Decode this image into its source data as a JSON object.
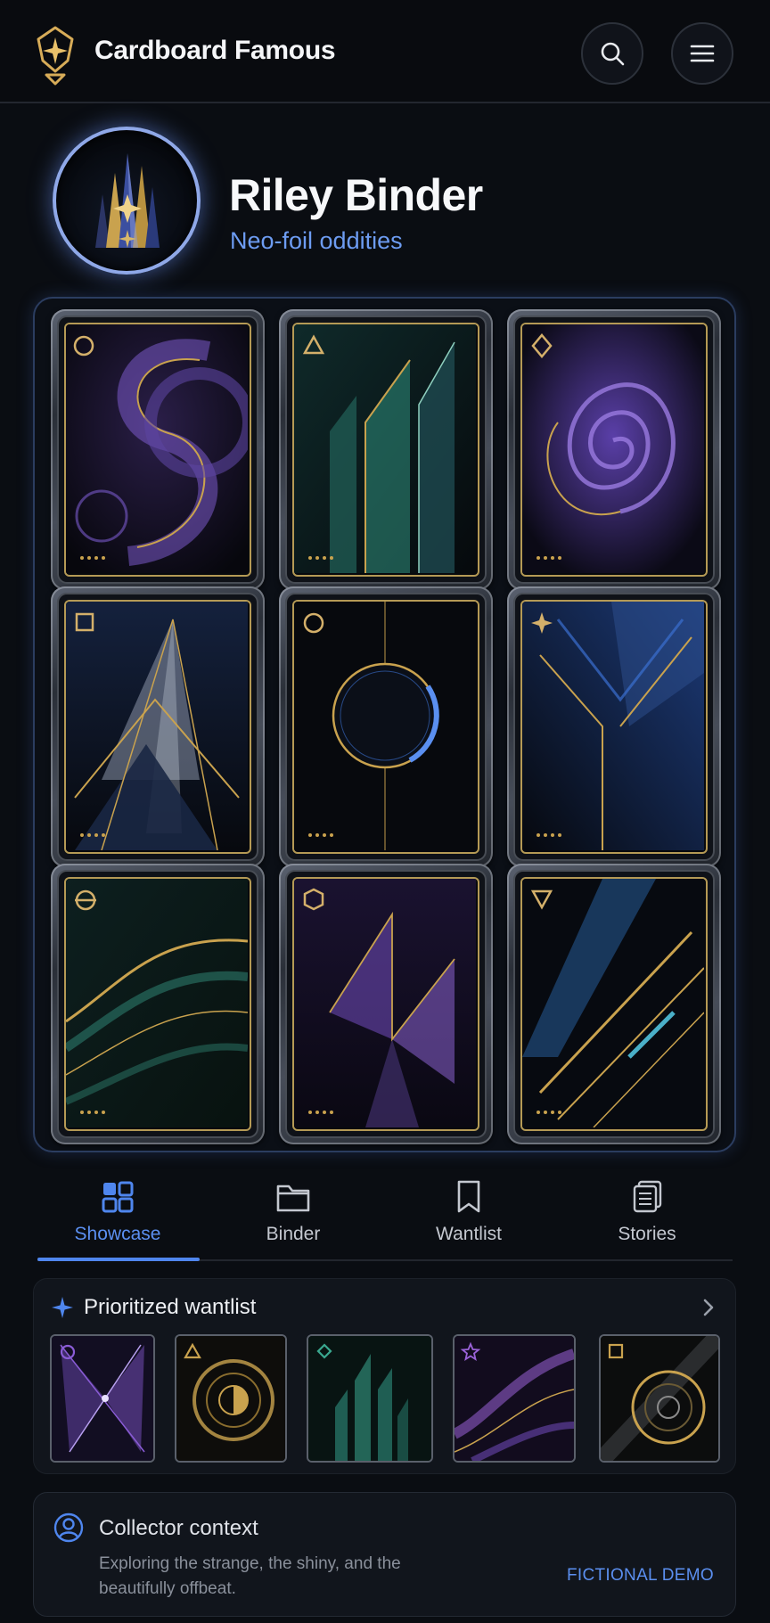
{
  "app": {
    "name": "Cardboard Famous"
  },
  "header": {
    "search_icon": "search-icon",
    "menu_icon": "hamburger-menu-icon"
  },
  "profile": {
    "name": "Riley Binder",
    "tagline": "Neo-foil oddities"
  },
  "binder": {
    "cards": [
      {
        "symbol": "circle",
        "theme": "purple swirl",
        "accent": "#7b55c8"
      },
      {
        "symbol": "triangle",
        "theme": "teal spires",
        "accent": "#2f8f7e"
      },
      {
        "symbol": "diamond",
        "theme": "purple vortex",
        "accent": "#6e4fc4"
      },
      {
        "symbol": "square",
        "theme": "blue peaks",
        "accent": "#3a5fa8"
      },
      {
        "symbol": "circle",
        "theme": "eclipse ring",
        "accent": "#3a6fd0"
      },
      {
        "symbol": "sparkle",
        "theme": "blue chevrons",
        "accent": "#2e4f90"
      },
      {
        "symbol": "theta",
        "theme": "teal waves",
        "accent": "#2c7a6a"
      },
      {
        "symbol": "hexagon",
        "theme": "violet shards",
        "accent": "#6a48b0"
      },
      {
        "symbol": "inverted-triangle",
        "theme": "blue streaks",
        "accent": "#2f6fb8"
      }
    ]
  },
  "tabs": [
    {
      "label": "Showcase",
      "icon": "grid-icon",
      "active": true
    },
    {
      "label": "Binder",
      "icon": "folder-icon",
      "active": false
    },
    {
      "label": "Wantlist",
      "icon": "bookmark-icon",
      "active": false
    },
    {
      "label": "Stories",
      "icon": "stack-icon",
      "active": false
    }
  ],
  "wantlist": {
    "title": "Prioritized wantlist",
    "items": [
      {
        "symbol": "circle",
        "accent": "#8a5cd6"
      },
      {
        "symbol": "triangle",
        "accent": "#c9a24e"
      },
      {
        "symbol": "diamond",
        "accent": "#3aa88f"
      },
      {
        "symbol": "star",
        "accent": "#9a62d8"
      },
      {
        "symbol": "square",
        "accent": "#c9a24e"
      }
    ]
  },
  "context": {
    "title": "Collector context",
    "description": "Exploring the strange, the shiny, and the beautifully offbeat.",
    "badge": "FICTIONAL DEMO"
  },
  "colors": {
    "accent_blue": "#5b8ff0",
    "gold": "#c9a24e",
    "background": "#0a0d12"
  }
}
